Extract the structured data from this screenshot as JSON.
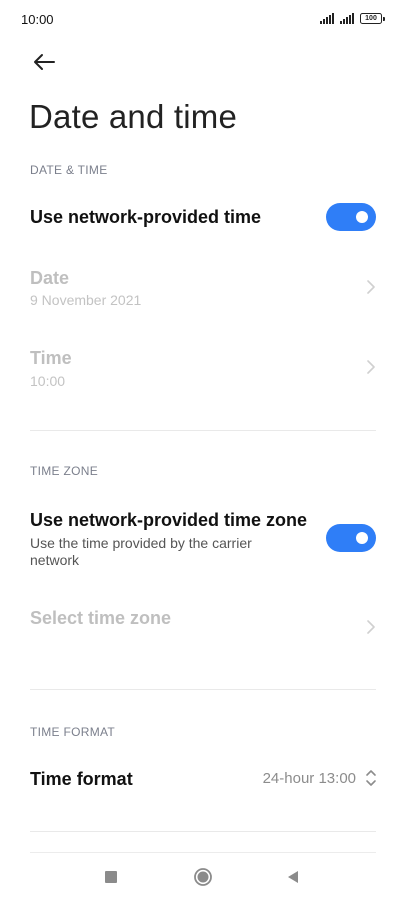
{
  "status_bar": {
    "time": "10:00",
    "battery": "100"
  },
  "page": {
    "title": "Date and time"
  },
  "sections": {
    "date_time": {
      "header": "DATE & TIME",
      "network_time_label": "Use network-provided time",
      "network_time_enabled": true,
      "date_label": "Date",
      "date_value": "9 November 2021",
      "time_label": "Time",
      "time_value": "10:00"
    },
    "time_zone": {
      "header": "TIME ZONE",
      "network_zone_label": "Use network-provided time zone",
      "network_zone_desc": "Use the time provided by the carrier network",
      "network_zone_enabled": true,
      "select_zone_label": "Select time zone"
    },
    "time_format": {
      "header": "TIME FORMAT",
      "label": "Time format",
      "value": "24-hour 13:00"
    }
  },
  "colors": {
    "accent": "#2f7ef7",
    "disabled_text": "#bfbfbf",
    "section_header": "#7b7f8c"
  },
  "icons": {
    "back": "arrow-left-icon",
    "chevron": "chevron-right-icon",
    "updown": "unfold-icon"
  }
}
